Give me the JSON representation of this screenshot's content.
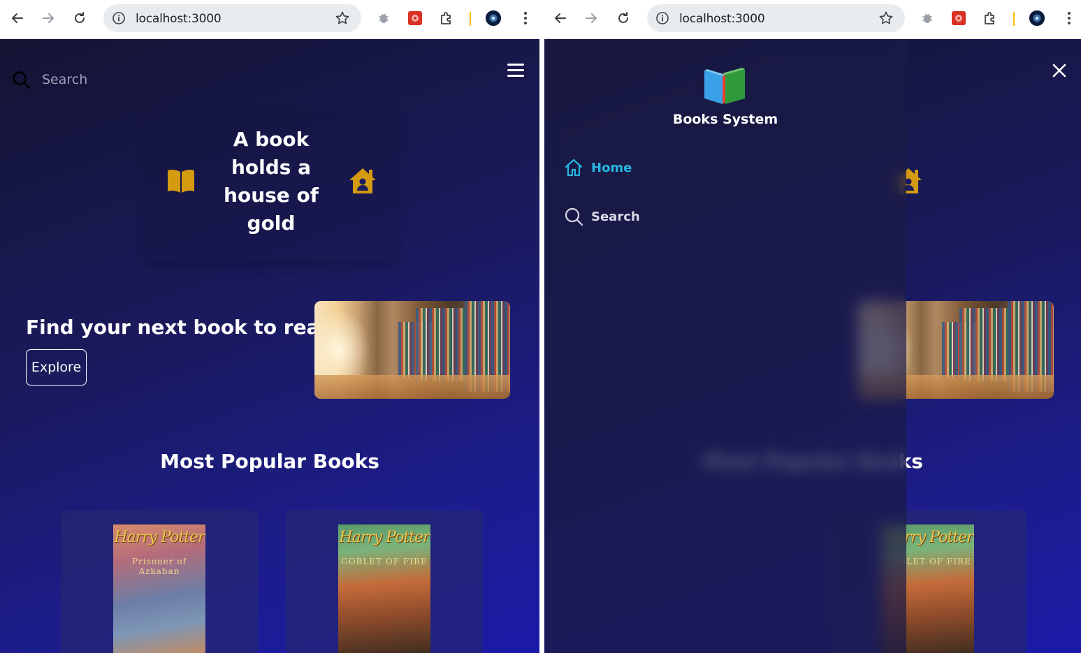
{
  "browser": {
    "url": "localhost:3000"
  },
  "colors": {
    "accent_cyan": "#25b7e3",
    "gold_icon": "#d49a10",
    "page_bg_start": "#141433",
    "page_bg_end": "#1b1aa8"
  },
  "page": {
    "search_placeholder": "Search",
    "quote": "A book holds a house of gold",
    "hero_title": "Find your next book to read",
    "explore_label": "Explore",
    "popular_title": "Most Popular Books",
    "books": [
      {
        "cover_title": "Harry Potter",
        "cover_sub": "Prisoner of Azkaban"
      },
      {
        "cover_title": "Harry Potter",
        "cover_sub": "GOBLET OF FIRE"
      }
    ],
    "icons": [
      "search-icon",
      "hamburger-menu-icon",
      "open-book-icon",
      "house-icon"
    ]
  },
  "drawer": {
    "brand": "Books System",
    "items": [
      {
        "label": "Home",
        "icon": "home-icon",
        "active": true
      },
      {
        "label": "Search",
        "icon": "search-icon",
        "active": false
      }
    ],
    "close_icon": "close-icon"
  }
}
